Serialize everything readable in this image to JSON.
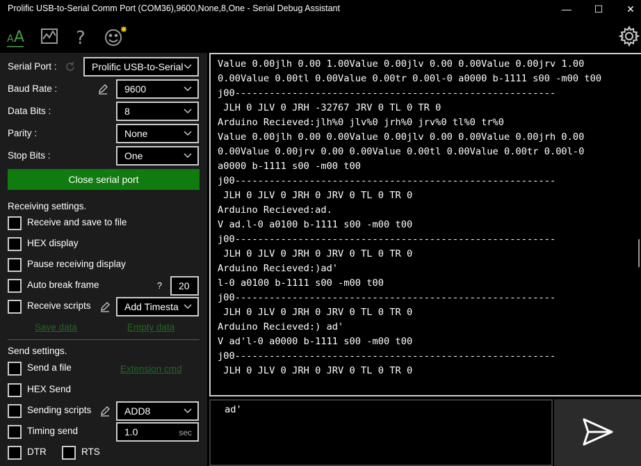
{
  "window": {
    "title": "Prolific USB-to-Serial Comm Port (COM36),9600,None,8,One - Serial Debug Assistant",
    "minimize_glyph": "—",
    "maximize_glyph": "☐",
    "close_glyph": "✕"
  },
  "toolbar": {
    "icons": [
      "font-size-icon",
      "chart-icon",
      "help-icon",
      "emoji-icon"
    ],
    "settings_icon": "gear-icon"
  },
  "serial": {
    "port_label": "Serial Port :",
    "port_value": "Prolific USB-to-Serial",
    "baud_label": "Baud Rate :",
    "baud_value": "9600",
    "databits_label": "Data Bits :",
    "databits_value": "8",
    "parity_label": "Parity :",
    "parity_value": "None",
    "stopbits_label": "Stop Bits :",
    "stopbits_value": "One",
    "close_button": "Close serial port"
  },
  "receiving": {
    "title": "Receiving settings.",
    "save_to_file": "Receive and save to file",
    "hex_display": "HEX display",
    "pause_display": "Pause receiving display",
    "auto_break": "Auto break frame",
    "auto_break_help": "?",
    "auto_break_value": "20",
    "receive_scripts": "Receive scripts",
    "script_value": "Add Timesta",
    "save_data": "Save data",
    "empty_data": "Empty data"
  },
  "sending": {
    "title": "Send settings.",
    "send_file": "Send a file",
    "extension_cmd": "Extension cmd",
    "hex_send": "HEX Send",
    "sending_scripts": "Sending scripts",
    "script_value": "ADD8",
    "timing_send": "Timing send",
    "timing_value": "1.0",
    "timing_unit": "sec",
    "dtr": "DTR",
    "rts": "RTS"
  },
  "output": {
    "lines": [
      "Value 0.00jlh 0.00 1.00Value 0.00jlv 0.00 0.00Value 0.00jrv 1.00",
      "0.00Value 0.00tl 0.00Value 0.00tr 0.00l-0 a0000 b-1111 s00 -m00 t00",
      "j00--------------------------------------------------------",
      " JLH 0 JLV 0 JRH -32767 JRV 0 TL 0 TR 0",
      "Arduino Recieved:jlh%0 jlv%0 jrh%0 jrv%0 tl%0 tr%0",
      "Value 0.00jlh 0.00 0.00Value 0.00jlv 0.00 0.00Value 0.00jrh 0.00",
      "0.00Value 0.00jrv 0.00 0.00Value 0.00tl 0.00Value 0.00tr 0.00l-0",
      "a0000 b-1111 s00 -m00 t00",
      "j00--------------------------------------------------------",
      " JLH 0 JLV 0 JRH 0 JRV 0 TL 0 TR 0",
      "Arduino Recieved:ad.",
      "V ad.l-0 a0100 b-1111 s00 -m00 t00",
      "j00--------------------------------------------------------",
      " JLH 0 JLV 0 JRH 0 JRV 0 TL 0 TR 0",
      "Arduino Recieved:)ad'",
      "l-0 a0100 b-1111 s00 -m00 t00",
      "j00--------------------------------------------------------",
      " JLH 0 JLV 0 JRH 0 JRV 0 TL 0 TR 0",
      "Arduino Recieved:) ad'",
      "V ad'l-0 a0000 b-1111 s00 -m00 t00",
      "j00--------------------------------------------------------",
      " JLH 0 JLV 0 JRH 0 JRV 0 TL 0 TR 0"
    ]
  },
  "send_box": {
    "value": "ad'"
  },
  "colors": {
    "accent_green": "#107c10",
    "link_green": "#226622",
    "panel": "#1c1c1c",
    "background": "#000000"
  }
}
